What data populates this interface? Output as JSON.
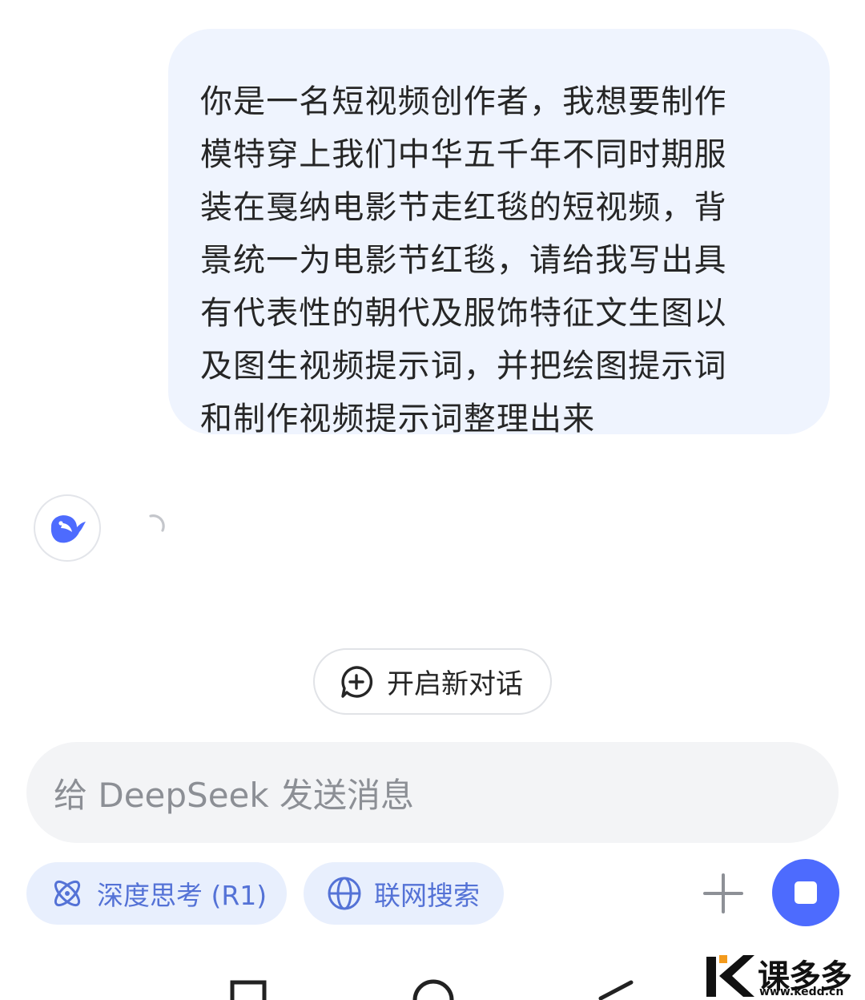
{
  "user_message": {
    "lines": [
      "你是一名短视频创作者，我想要制作",
      "模特穿上我们中华五千年不同时期服",
      "装在戛纳电影节走红毯的短视频，背",
      "景统一为电影节红毯，请给我写出具",
      "有代表性的朝代及服饰特征文生图以",
      "及图生视频提示词，并把绘图提示词",
      "和制作视频提示词整理出来"
    ]
  },
  "assistant": {
    "avatar_icon": "deepseek-whale-icon",
    "status": "loading"
  },
  "new_chat_button": {
    "label": "开启新对话",
    "icon": "chat-plus-icon"
  },
  "input": {
    "placeholder": "给 DeepSeek 发送消息"
  },
  "chips": {
    "deepthink": {
      "label": "深度思考 (R1)",
      "icon": "atom-icon"
    },
    "search": {
      "label": "联网搜索",
      "icon": "globe-icon"
    }
  },
  "actions": {
    "add_icon": "plus-icon",
    "stop_icon": "stop-icon"
  },
  "watermark": {
    "brand": "课多多",
    "url": "www.kedd.cn"
  },
  "colors": {
    "accent": "#4d6bfe",
    "user_bubble": "#eff4fe",
    "chip_bg": "#e8effd",
    "chip_text": "#5472d6",
    "input_bg": "#f3f4f6",
    "watermark_orange": "#f39a1c"
  }
}
